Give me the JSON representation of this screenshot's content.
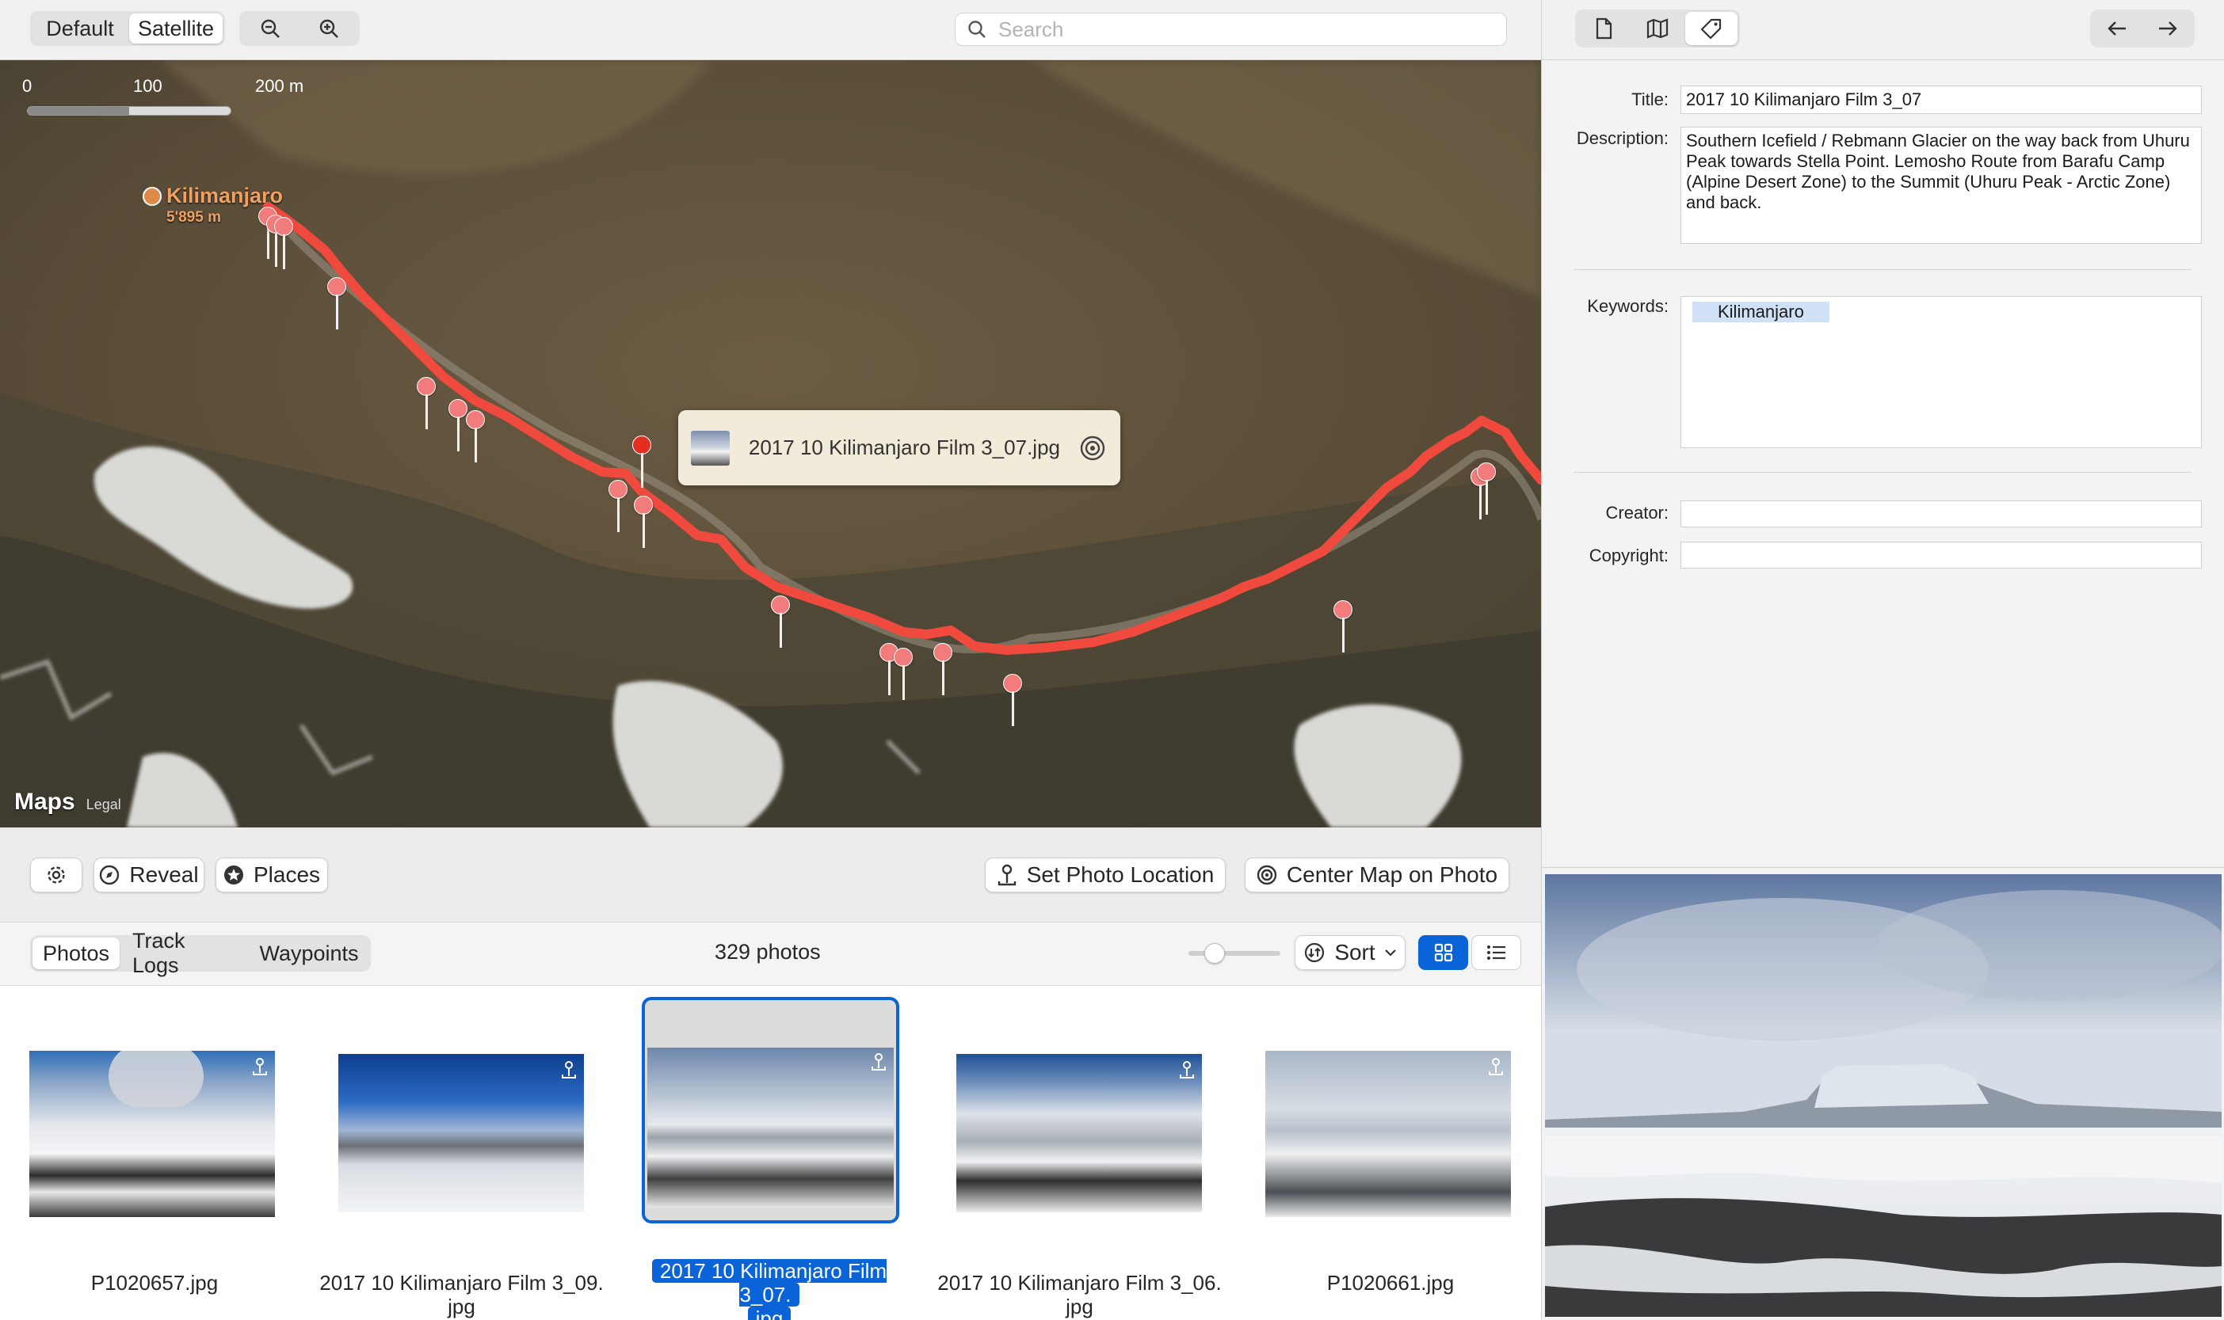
{
  "toolbar": {
    "map_type_options": [
      "Default",
      "Satellite"
    ],
    "map_type_selected": "Satellite",
    "zoom_out_icon": "zoom-out-icon",
    "zoom_in_icon": "zoom-in-icon",
    "search_placeholder": "Search"
  },
  "map": {
    "scale_labels": [
      "0",
      "100",
      "200 m"
    ],
    "peak_name": "Kilimanjaro",
    "peak_elevation": "5'895 m",
    "callout_title": "2017 10 Kilimanjaro Film 3_07.jpg",
    "attribution_logo": "Maps",
    "attribution_legal": "Legal",
    "route_color": "#ef4a3d",
    "pin_color": "#f27c7c"
  },
  "map_controls": {
    "settings_icon": "gear-icon",
    "reveal_label": "Reveal",
    "places_label": "Places",
    "set_location_label": "Set Photo Location",
    "center_map_label": "Center Map on Photo"
  },
  "browser": {
    "tabs": [
      "Photos",
      "Track Logs",
      "Waypoints"
    ],
    "selected_tab": "Photos",
    "photo_count": "329 photos",
    "sort_label": "Sort",
    "view_modes": [
      "grid-view-icon",
      "list-view-icon"
    ],
    "selected_view": "grid-view-icon"
  },
  "photos": [
    {
      "caption_line1": "P1020657.jpg",
      "caption_line2": ""
    },
    {
      "caption_line1": "2017 10 Kilimanjaro Film 3_09.",
      "caption_line2": "jpg"
    },
    {
      "caption_line1": "2017 10 Kilimanjaro Film 3_07.",
      "caption_line2": "jpg",
      "selected": true
    },
    {
      "caption_line1": "2017 10 Kilimanjaro Film 3_06.",
      "caption_line2": "jpg"
    },
    {
      "caption_line1": "P1020661.jpg",
      "caption_line2": ""
    }
  ],
  "inspector": {
    "tabs": [
      "document-icon",
      "map-icon",
      "tag-icon"
    ],
    "selected_tab": "tag-icon",
    "nav": [
      "arrow-left-icon",
      "arrow-right-icon"
    ],
    "title_label": "Title:",
    "title_value": "2017 10 Kilimanjaro Film 3_07",
    "description_label": "Description:",
    "description_value": "Southern Icefield / Rebmann Glacier on the way back from Uhuru Peak towards Stella Point. Lemosho Route from Barafu Camp (Alpine Desert Zone) to the Summit (Uhuru Peak - Arctic Zone) and back.",
    "keywords_label": "Keywords:",
    "keywords": [
      "Kilimanjaro"
    ],
    "creator_label": "Creator:",
    "creator_value": "",
    "copyright_label": "Copyright:",
    "copyright_value": ""
  },
  "colors": {
    "accent": "#0a64d8",
    "selection": "#0a64d8"
  }
}
